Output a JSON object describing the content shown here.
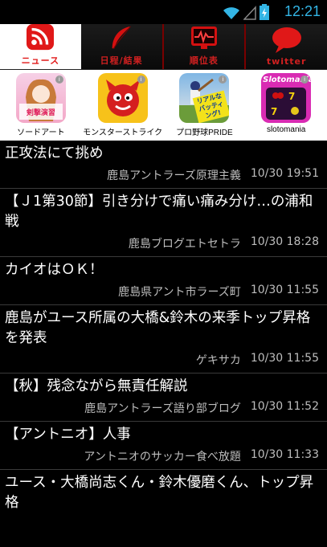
{
  "status": {
    "time": "12:21"
  },
  "tabs": [
    {
      "label": "ニュース",
      "icon": "rss-icon"
    },
    {
      "label": "日程/結果",
      "icon": "feather-icon"
    },
    {
      "label": "順位表",
      "icon": "chart-icon"
    },
    {
      "label": "twitter",
      "icon": "speech-bubble-icon"
    }
  ],
  "ads": [
    {
      "label": "ソードアート",
      "badge_text": "剣撃演習"
    },
    {
      "label": "モンスターストライク"
    },
    {
      "label": "プロ野球PRIDE",
      "badge_text": "リアルなバッティング!"
    },
    {
      "label": "slotomania",
      "badge_text": "Slotomania"
    }
  ],
  "articles": [
    {
      "title": "正攻法にて挑め",
      "source": "鹿島アントラーズ原理主義",
      "date": "10/30 19:51"
    },
    {
      "title": "【Ｊ1第30節】引き分けで痛い痛み分け…の浦和戦",
      "source": "鹿島ブログエトセトラ",
      "date": "10/30 18:28"
    },
    {
      "title": "カイオはＯＫ！",
      "source": "鹿島県アント市ラーズ町",
      "date": "10/30 11:55"
    },
    {
      "title": "鹿島がユース所属の大橋&鈴木の来季トップ昇格を発表",
      "source": "ゲキサカ",
      "date": "10/30 11:55"
    },
    {
      "title": "【秋】残念ながら無責任解説",
      "source": "鹿島アントラーズ語り部ブログ",
      "date": "10/30 11:52"
    },
    {
      "title": "【アントニオ】人事",
      "source": "アントニオのサッカー食べ放題",
      "date": "10/30 11:33"
    },
    {
      "title": "ユース・大橋尚志くん・鈴木優磨くん、トップ昇格",
      "source": "",
      "date": ""
    }
  ]
}
